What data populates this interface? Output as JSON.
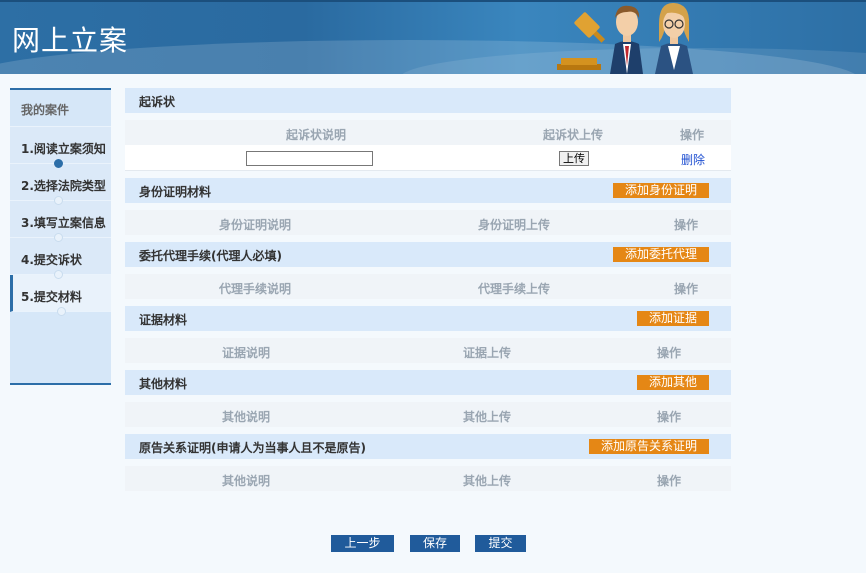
{
  "header": {
    "title": "网上立案"
  },
  "sidebar": {
    "heading": "我的案件",
    "items": [
      {
        "label": "1.阅读立案须知"
      },
      {
        "label": "2.选择法院类型"
      },
      {
        "label": "3.填写立案信息"
      },
      {
        "label": "4.提交诉状"
      },
      {
        "label": "5.提交材料"
      }
    ]
  },
  "sections": {
    "complaint": {
      "title": "起诉状",
      "columns": [
        "起诉状说明",
        "起诉状上传",
        "操作"
      ],
      "upload_label": "上传",
      "delete_label": "删除"
    },
    "identity": {
      "title": "身份证明材料",
      "add_label": "添加身份证明",
      "columns": [
        "身份证明说明",
        "身份证明上传",
        "操作"
      ]
    },
    "agent": {
      "title": "委托代理手续(代理人必填)",
      "add_label": "添加委托代理",
      "columns": [
        "代理手续说明",
        "代理手续上传",
        "操作"
      ]
    },
    "evidence": {
      "title": "证据材料",
      "add_label": "添加证据",
      "columns": [
        "证据说明",
        "证据上传",
        "操作"
      ]
    },
    "other": {
      "title": "其他材料",
      "add_label": "添加其他",
      "columns": [
        "其他说明",
        "其他上传",
        "操作"
      ]
    },
    "relation": {
      "title": "原告关系证明(申请人为当事人且不是原告)",
      "add_label": "添加原告关系证明",
      "columns": [
        "其他说明",
        "其他上传",
        "操作"
      ]
    }
  },
  "footer": {
    "prev_label": "上一步",
    "save_label": "保存",
    "submit_label": "提交"
  },
  "colors": {
    "primary": "#205b9b",
    "accent": "#e58715",
    "section_bg": "#d9e9fa"
  }
}
